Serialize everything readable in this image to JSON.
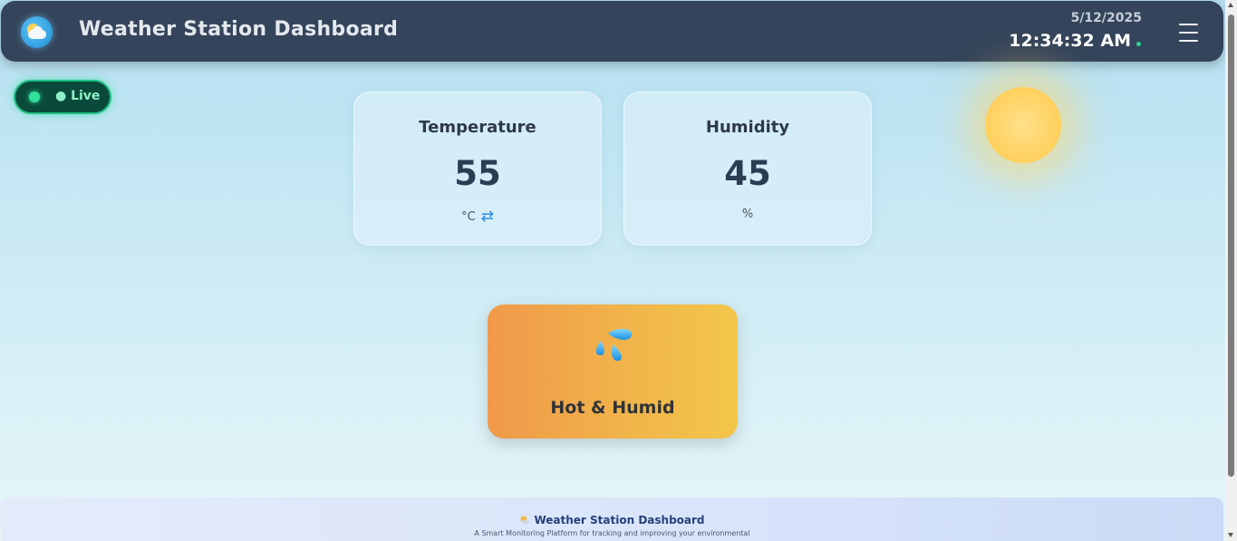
{
  "header": {
    "title": "Weather Station Dashboard",
    "logo_icon": "weather-partly-cloudy-icon",
    "date": "5/12/2025",
    "time": "12:34:32 AM",
    "menu_icon": "hamburger-menu-icon"
  },
  "live": {
    "label": "● Live",
    "color": "#2fe09a"
  },
  "cards": [
    {
      "title": "Temperature",
      "value": "55",
      "unit": "°C",
      "swap_icon": "⇄"
    },
    {
      "title": "Humidity",
      "value": "45",
      "unit": "%"
    }
  ],
  "status": {
    "label": "Hot & Humid",
    "icon": "water-drops-icon",
    "gradient": [
      "#f0994a",
      "#f2c74a"
    ]
  },
  "footer": {
    "title": "Weather Station Dashboard",
    "subtitle": "A Smart Monitoring Platform for tracking and improving your environmental"
  },
  "colors": {
    "header_bg": "#34445a",
    "accent_green": "#2fe09a",
    "accent_blue": "#1f86e0"
  }
}
